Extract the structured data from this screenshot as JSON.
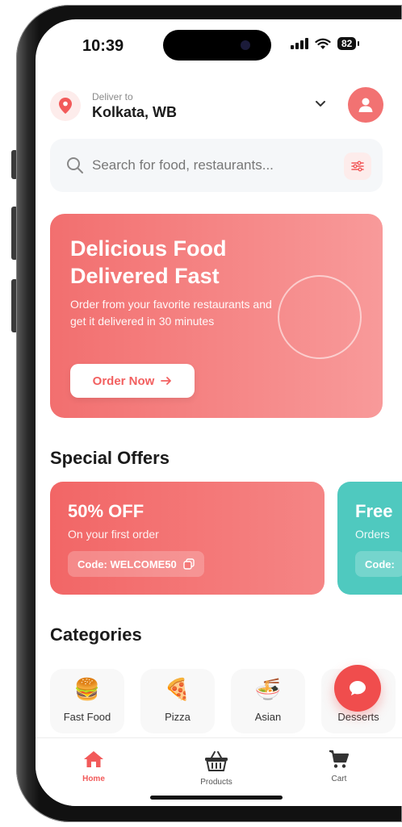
{
  "status_bar": {
    "time": "10:39",
    "battery": "82"
  },
  "header": {
    "deliver_label": "Deliver to",
    "city": "Kolkata, WB"
  },
  "search": {
    "placeholder": "Search for food, restaurants..."
  },
  "hero": {
    "title": "Delicious Food\nDelivered Fast",
    "subtitle": "Order from your favorite restaurants and get it delivered in 30 minutes",
    "button_label": "Order Now"
  },
  "special_offers": {
    "title": "Special Offers",
    "items": [
      {
        "title": "50% OFF",
        "subtitle": "On your first order",
        "code": "Code: WELCOME50",
        "color": "#f26666"
      },
      {
        "title": "Free",
        "subtitle": "Orders",
        "code": "Code:",
        "color": "#4fc9bf"
      }
    ]
  },
  "categories": {
    "title": "Categories",
    "items": [
      {
        "label": "Fast Food",
        "icon": "burger-icon",
        "glyph": "🍔"
      },
      {
        "label": "Pizza",
        "icon": "pizza-icon",
        "glyph": "🍕"
      },
      {
        "label": "Asian",
        "icon": "noodles-icon",
        "glyph": "🍜"
      },
      {
        "label": "Desserts",
        "icon": "dessert-icon",
        "glyph": ""
      }
    ]
  },
  "bottom_nav": {
    "items": [
      {
        "label": "Home",
        "icon": "home-icon",
        "active": true
      },
      {
        "label": "Products",
        "icon": "basket-icon",
        "active": false
      },
      {
        "label": "Cart",
        "icon": "cart-icon",
        "active": false
      }
    ]
  },
  "colors": {
    "accent": "#f25a5a",
    "teal": "#4fc9bf"
  }
}
